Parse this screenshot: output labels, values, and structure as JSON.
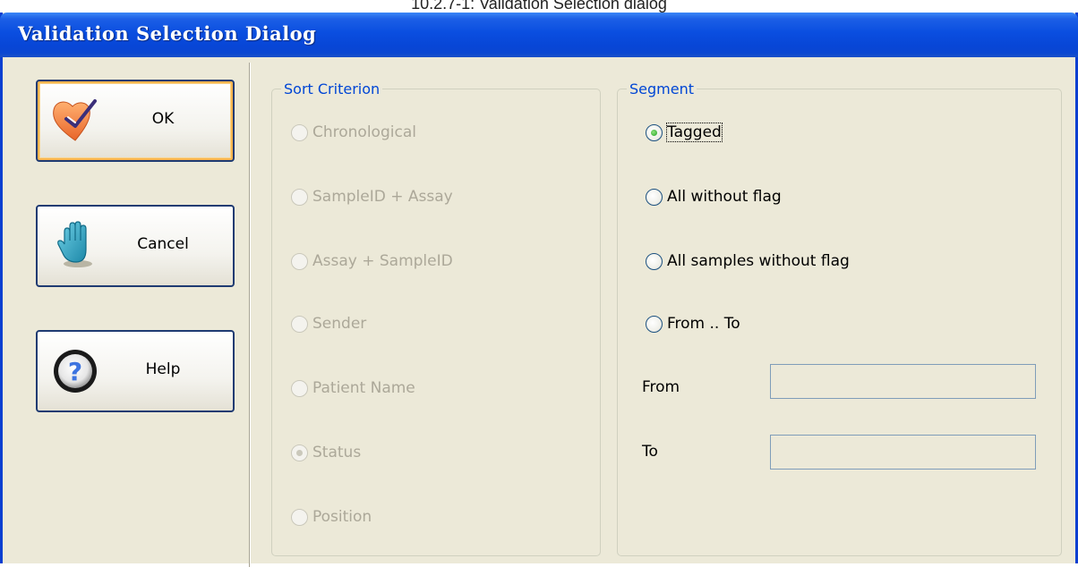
{
  "document": {
    "caption": "10.2.7-1: Validation Selection dialog"
  },
  "dialog": {
    "title": "Validation Selection Dialog",
    "buttons": [
      {
        "label": "OK",
        "icon": "checkmark-heart-icon"
      },
      {
        "label": "Cancel",
        "icon": "hand-icon"
      },
      {
        "label": "Help",
        "icon": "question-mark-icon"
      }
    ],
    "sort_criterion": {
      "legend": "Sort Criterion",
      "options": [
        {
          "label": "Chronological",
          "checked": false
        },
        {
          "label": "SampleID + Assay",
          "checked": false
        },
        {
          "label": "Assay + SampleID",
          "checked": false
        },
        {
          "label": "Sender",
          "checked": false
        },
        {
          "label": "Patient Name",
          "checked": false
        },
        {
          "label": "Status",
          "checked": true
        },
        {
          "label": "Position",
          "checked": false
        }
      ]
    },
    "segment": {
      "legend": "Segment",
      "options": [
        {
          "label": "Tagged",
          "checked": true
        },
        {
          "label": "All without flag",
          "checked": false
        },
        {
          "label": "All samples without flag",
          "checked": false
        },
        {
          "label": "From .. To",
          "checked": false
        }
      ],
      "from_label": "From",
      "from_value": "",
      "to_label": "To",
      "to_value": ""
    }
  },
  "colors": {
    "titlebar": "#0a4ee0",
    "dialog_bg": "#ece9d8",
    "legend": "#0046d5",
    "disabled_text": "#aca899"
  }
}
